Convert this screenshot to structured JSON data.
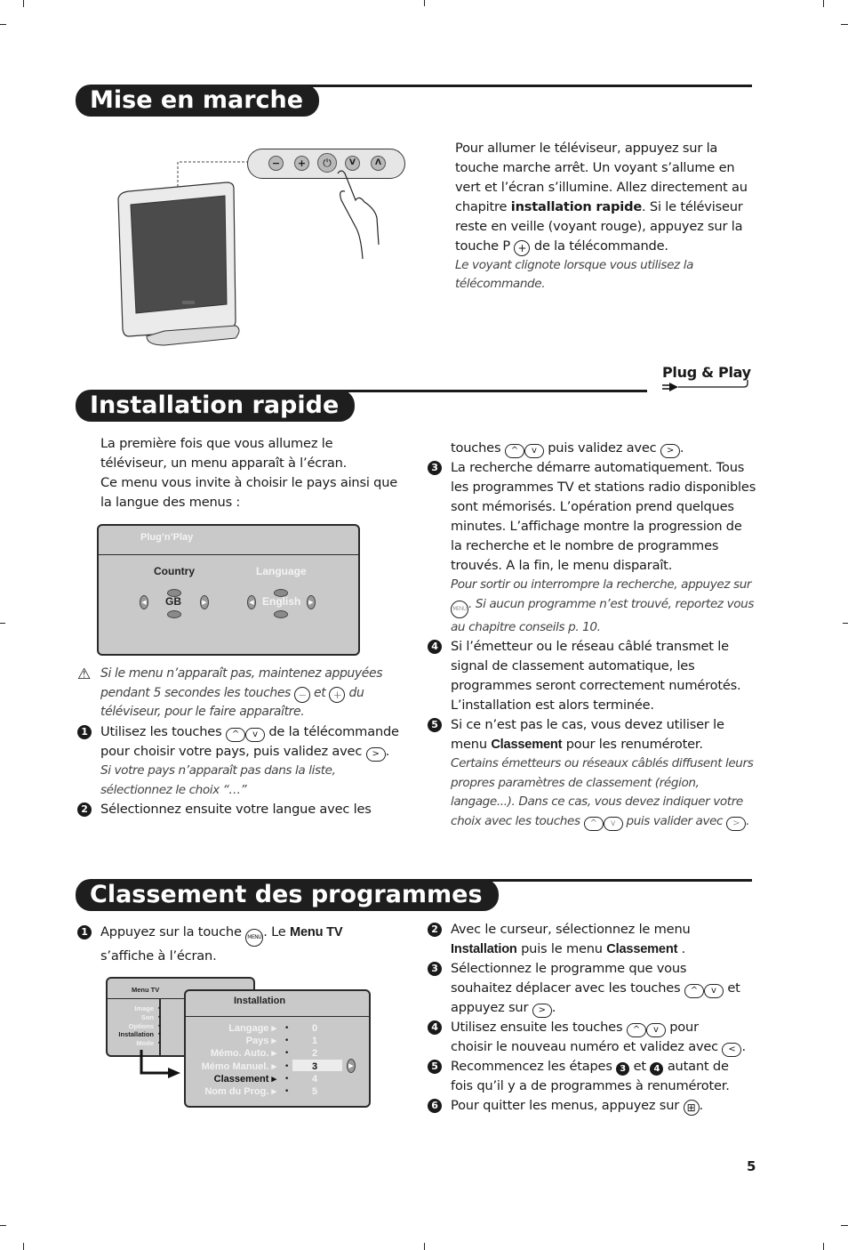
{
  "page_number": "5",
  "sections": {
    "mise_en_marche": {
      "title": "Mise en marche",
      "tv_buttons": [
        "minus",
        "plus",
        "power",
        "down",
        "up"
      ],
      "text_lines": [
        "Pour allumer le téléviseur, appuyez sur la",
        "touche marche arrêt. Un voyant s’allume en",
        "vert et l’écran s’illumine. Allez directement au"
      ],
      "text_chapitre_pre": "chapitre ",
      "text_chapitre_bold": "installation rapide",
      "text_chapitre_post": ". Si le téléviseur",
      "text_veille": "reste en veille (voyant rouge), appuyez sur la",
      "text_touche_pre": "touche P ",
      "text_touche_post": " de la télécommande.",
      "note": "Le voyant clignote lorsque vous utilisez la télécommande."
    },
    "installation_rapide": {
      "title": "Installation rapide",
      "logo": "Plug & Play",
      "intro": [
        "La première fois que vous allumez le",
        "téléviseur, un menu apparaît à l’écran.",
        "Ce menu vous invite à choisir le pays ainsi que",
        "la langue des menus :"
      ],
      "osd": {
        "title": "Plug’n’Play",
        "country_label": "Country",
        "country_value": "GB",
        "language_label": "Language",
        "language_value": "English"
      },
      "warning": {
        "part1": "Si le menu n’apparaît pas, maintenez appuyées",
        "part2_pre": "pendant 5 secondes les touches ",
        "part2_mid": " et ",
        "part2_post": " du",
        "part3": "téléviseur, pour le faire apparaître."
      },
      "steps": [
        {
          "num": "1",
          "line1_pre": "Utilisez les touches ",
          "line1_post": " de la télécommande",
          "line2_pre": "pour choisir votre pays, puis validez avec ",
          "line2_post": ".",
          "note": "Si votre pays n’apparaît pas dans la liste, sélectionnez le choix “…”"
        },
        {
          "num": "2",
          "line1": "Sélectionnez ensuite votre langue avec les",
          "line2_pre": "touches ",
          "line2_mid": " puis validez avec ",
          "line2_post": "."
        },
        {
          "num": "3",
          "text": "La recherche démarre automatiquement. Tous les programmes TV et stations radio disponibles sont mémorisés. L’opération prend quelques minutes. L’affichage montre la progression de la recherche et le nombre de programmes trouvés.  A la fin, le menu disparaît.",
          "note_pre": "Pour sortir ou interrompre la recherche, appuyez sur ",
          "note_post": ". Si aucun programme n’est trouvé, reportez vous au chapitre conseils p. 10."
        },
        {
          "num": "4",
          "text": "Si l’émetteur ou le réseau câblé transmet le signal de classement automatique, les programmes seront correctement numérotés. L’installation est alors terminée."
        },
        {
          "num": "5",
          "pre": "Si ce n’est pas le cas, vous devez utiliser le menu ",
          "bold": "Classement",
          "post": " pour les renuméroter.",
          "note_pre": "Certains émetteurs ou réseaux câblés diffusent leurs propres paramètres de classement (région, langage...). Dans ce cas, vous devez indiquer votre choix avec les touches ",
          "note_mid": " puis valider avec ",
          "note_post": "."
        }
      ]
    },
    "classement": {
      "title": "Classement des programmes",
      "step1": {
        "num": "1",
        "pre": "Appuyez sur la touche ",
        "mid": ". Le ",
        "bold": "Menu TV",
        "line2": "s’affiche à l’écran."
      },
      "menu_tv": {
        "title": "Menu TV",
        "items": [
          "Image",
          "Son",
          "Options",
          "Installation",
          "Mode"
        ],
        "active": "Installation"
      },
      "installation_menu": {
        "title": "Installation",
        "items": [
          "Langage",
          "Pays",
          "Mémo. Auto.",
          "Mémo Manuel.",
          "Classement",
          "Nom du Prog."
        ],
        "active": "Classement",
        "numbers": [
          "0",
          "1",
          "2",
          "3",
          "4",
          "5"
        ],
        "selected_number": "3"
      },
      "steps": [
        {
          "num": "2",
          "l1": "Avec le curseur, sélectionnez le menu",
          "b1": "Installation",
          "m1": " puis le menu ",
          "b2": "Classement",
          "e1": " ."
        },
        {
          "num": "3",
          "l1": "Sélectionnez le programme que vous",
          "l2_pre": "souhaitez déplacer avec les touches ",
          "l2_post": " et",
          "l3_pre": "appuyez sur ",
          "l3_post": "."
        },
        {
          "num": "4",
          "l1_pre": "Utilisez ensuite les touches ",
          "l1_post": " pour",
          "l2_pre": "choisir le nouveau numéro et validez avec ",
          "l2_post": "."
        },
        {
          "num": "5",
          "l1_pre": "Recommencez les étapes ",
          "ref1": "3",
          "l1_mid": " et ",
          "ref2": "4",
          "l1_post": " autant de",
          "l2": "fois qu’il y a de programmes à renuméroter."
        },
        {
          "num": "6",
          "l1_pre": "Pour quitter les menus, appuyez sur ",
          "l1_post": "."
        }
      ]
    }
  },
  "keys": {
    "up": "^",
    "down": "v",
    "right": ">",
    "left": "<",
    "plus": "+",
    "minus": "−",
    "menu": "MENU",
    "exit": "⊞"
  }
}
